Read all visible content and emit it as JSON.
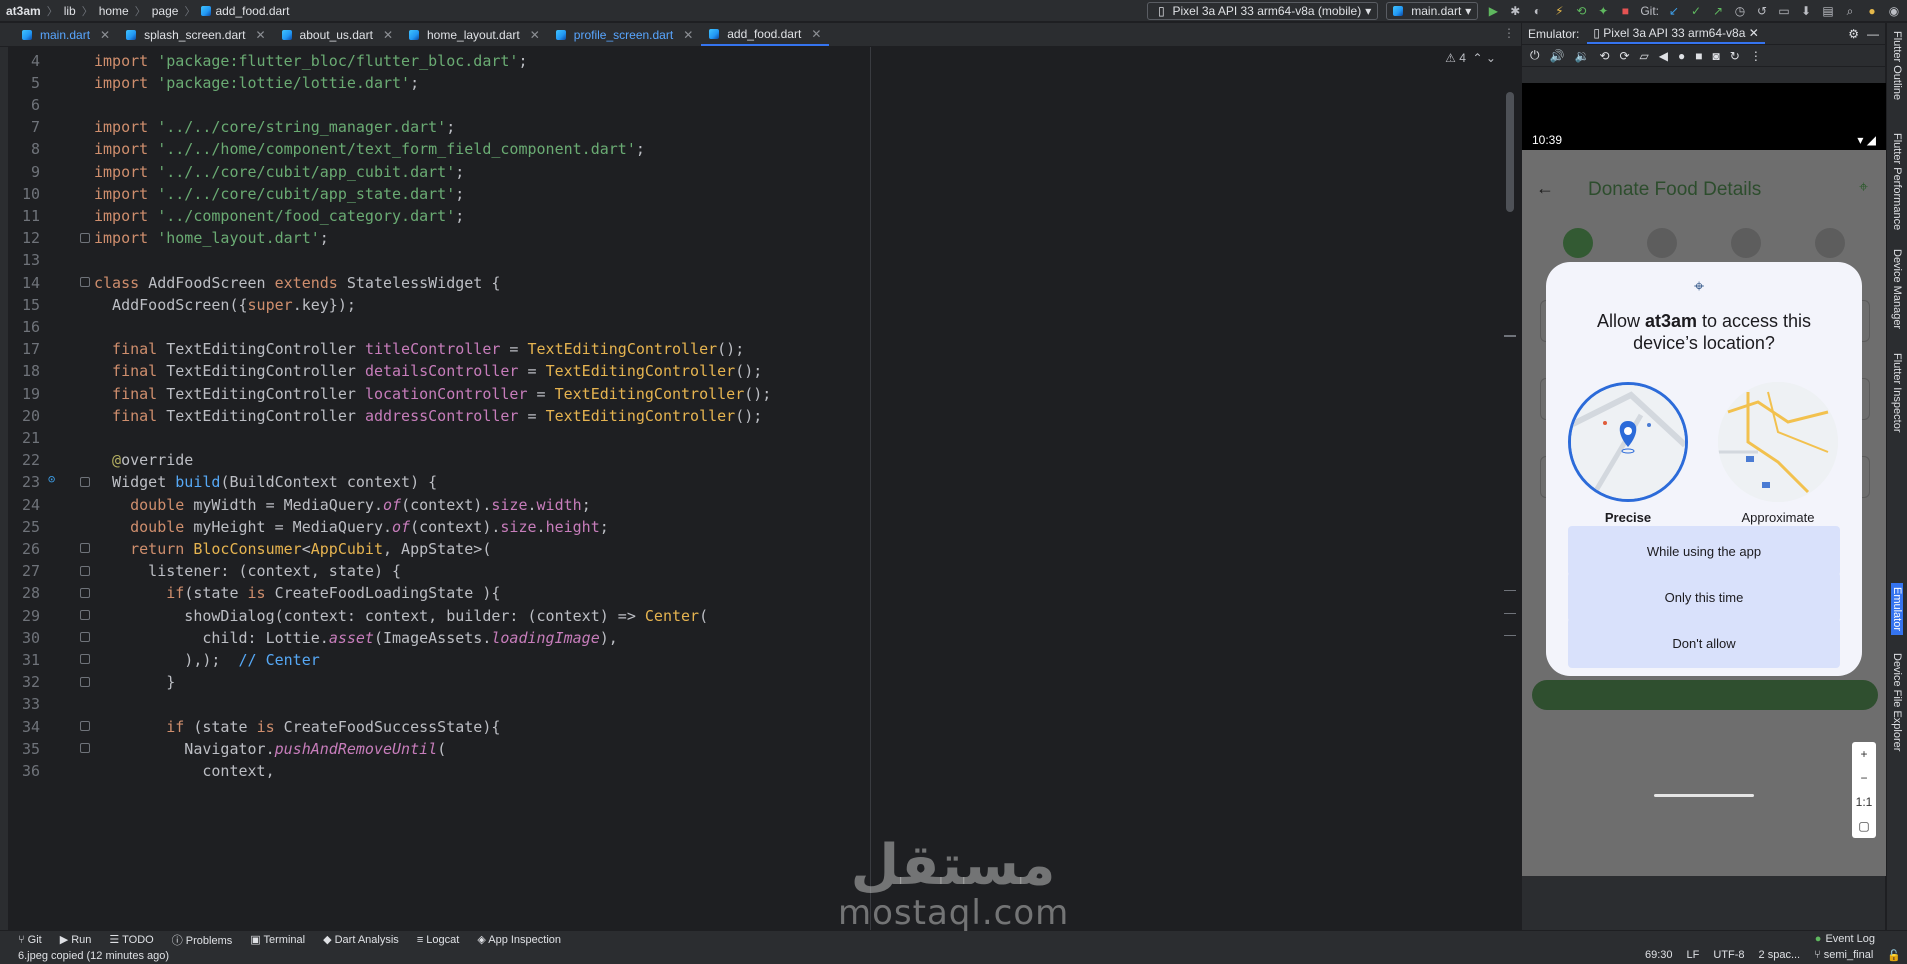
{
  "breadcrumb": {
    "project": "at3am",
    "parts": [
      "lib",
      "home",
      "page"
    ],
    "file": "add_food.dart"
  },
  "toolbar": {
    "device": "Pixel 3a API 33 arm64-v8a (mobile)",
    "config": "main.dart",
    "git_label": "Git:"
  },
  "tabs": [
    {
      "label": "main.dart",
      "modified": true
    },
    {
      "label": "splash_screen.dart",
      "modified": false
    },
    {
      "label": "about_us.dart",
      "modified": false
    },
    {
      "label": "home_layout.dart",
      "modified": false
    },
    {
      "label": "profile_screen.dart",
      "modified": true
    },
    {
      "label": "add_food.dart",
      "modified": false,
      "active": true
    }
  ],
  "editor": {
    "warning_count": "4",
    "lines": [
      {
        "n": "4",
        "tokens": [
          [
            "kw",
            "import "
          ],
          [
            "str",
            "'package:flutter_bloc/flutter_bloc.dart'"
          ],
          [
            "code",
            ";"
          ]
        ]
      },
      {
        "n": "5",
        "tokens": [
          [
            "kw",
            "import "
          ],
          [
            "str",
            "'package:lottie/lottie.dart'"
          ],
          [
            "code",
            ";"
          ]
        ]
      },
      {
        "n": "6",
        "tokens": []
      },
      {
        "n": "7",
        "tokens": [
          [
            "kw",
            "import "
          ],
          [
            "str",
            "'../../core/string_manager.dart'"
          ],
          [
            "code",
            ";"
          ]
        ]
      },
      {
        "n": "8",
        "tokens": [
          [
            "kw",
            "import "
          ],
          [
            "str",
            "'../../home/component/text_form_field_component.dart'"
          ],
          [
            "code",
            ";"
          ]
        ]
      },
      {
        "n": "9",
        "tokens": [
          [
            "kw",
            "import "
          ],
          [
            "str",
            "'../../core/cubit/app_cubit.dart'"
          ],
          [
            "code",
            ";"
          ]
        ]
      },
      {
        "n": "10",
        "tokens": [
          [
            "kw",
            "import "
          ],
          [
            "str",
            "'../../core/cubit/app_state.dart'"
          ],
          [
            "code",
            ";"
          ]
        ]
      },
      {
        "n": "11",
        "tokens": [
          [
            "kw",
            "import "
          ],
          [
            "str",
            "'../component/food_category.dart'"
          ],
          [
            "code",
            ";"
          ]
        ]
      },
      {
        "n": "12",
        "tokens": [
          [
            "kw",
            "import "
          ],
          [
            "str",
            "'home_layout.dart'"
          ],
          [
            "code",
            ";"
          ]
        ]
      },
      {
        "n": "13",
        "tokens": []
      },
      {
        "n": "14",
        "tokens": [
          [
            "kw",
            "class "
          ],
          [
            "code",
            "AddFoodScreen "
          ],
          [
            "kw",
            "extends "
          ],
          [
            "code",
            "StatelessWidget {"
          ]
        ]
      },
      {
        "n": "15",
        "tokens": [
          [
            "code",
            "  AddFoodScreen({"
          ],
          [
            "kw",
            "super"
          ],
          [
            "code",
            ".key});"
          ]
        ]
      },
      {
        "n": "16",
        "tokens": []
      },
      {
        "n": "17",
        "tokens": [
          [
            "kw",
            "  final "
          ],
          [
            "code",
            "TextEditingController "
          ],
          [
            "fld",
            "titleController"
          ],
          [
            "code",
            " = "
          ],
          [
            "ctor",
            "TextEditingController"
          ],
          [
            "code",
            "();"
          ]
        ]
      },
      {
        "n": "18",
        "tokens": [
          [
            "kw",
            "  final "
          ],
          [
            "code",
            "TextEditingController "
          ],
          [
            "fld",
            "detailsController"
          ],
          [
            "code",
            " = "
          ],
          [
            "ctor",
            "TextEditingController"
          ],
          [
            "code",
            "();"
          ]
        ]
      },
      {
        "n": "19",
        "tokens": [
          [
            "kw",
            "  final "
          ],
          [
            "code",
            "TextEditingController "
          ],
          [
            "fld",
            "locationController"
          ],
          [
            "code",
            " = "
          ],
          [
            "ctor",
            "TextEditingController"
          ],
          [
            "code",
            "();"
          ]
        ]
      },
      {
        "n": "20",
        "tokens": [
          [
            "kw",
            "  final "
          ],
          [
            "code",
            "TextEditingController "
          ],
          [
            "fld",
            "addressController"
          ],
          [
            "code",
            " = "
          ],
          [
            "ctor",
            "TextEditingController"
          ],
          [
            "code",
            "();"
          ]
        ]
      },
      {
        "n": "21",
        "tokens": []
      },
      {
        "n": "22",
        "tokens": [
          [
            "ann",
            "  @"
          ],
          [
            "code",
            "override"
          ]
        ]
      },
      {
        "n": "23",
        "tokens": [
          [
            "code",
            "  Widget "
          ],
          [
            "meth",
            "build"
          ],
          [
            "code",
            "(BuildContext context) {"
          ]
        ]
      },
      {
        "n": "24",
        "tokens": [
          [
            "kw",
            "    double "
          ],
          [
            "code",
            "myWidth = MediaQuery."
          ],
          [
            "ital",
            "of"
          ],
          [
            "code",
            "(context)."
          ],
          [
            "fld",
            "size"
          ],
          [
            "code",
            "."
          ],
          [
            "fld",
            "width"
          ],
          [
            "code",
            ";"
          ]
        ]
      },
      {
        "n": "25",
        "tokens": [
          [
            "kw",
            "    double "
          ],
          [
            "code",
            "myHeight = MediaQuery."
          ],
          [
            "ital",
            "of"
          ],
          [
            "code",
            "(context)."
          ],
          [
            "fld",
            "size"
          ],
          [
            "code",
            "."
          ],
          [
            "fld",
            "height"
          ],
          [
            "code",
            ";"
          ]
        ]
      },
      {
        "n": "26",
        "tokens": [
          [
            "kw",
            "    return "
          ],
          [
            "ctor",
            "BlocConsumer"
          ],
          [
            "code",
            "<"
          ],
          [
            "ctor",
            "AppCubit"
          ],
          [
            "code",
            ", AppState>("
          ]
        ]
      },
      {
        "n": "27",
        "tokens": [
          [
            "code",
            "      listener: (context, state) {"
          ]
        ]
      },
      {
        "n": "28",
        "tokens": [
          [
            "kw",
            "        if"
          ],
          [
            "code",
            "(state "
          ],
          [
            "kw",
            "is "
          ],
          [
            "code",
            "CreateFoodLoadingState ){"
          ]
        ]
      },
      {
        "n": "29",
        "tokens": [
          [
            "code",
            "          showDialog(context: context, builder: (context) => "
          ],
          [
            "ctor",
            "Center"
          ],
          [
            "code",
            "("
          ]
        ]
      },
      {
        "n": "30",
        "tokens": [
          [
            "code",
            "            child: Lottie."
          ],
          [
            "ital",
            "asset"
          ],
          [
            "code",
            "(ImageAssets."
          ],
          [
            "ital",
            "loadingImage"
          ],
          [
            "code",
            "),"
          ]
        ]
      },
      {
        "n": "31",
        "tokens": [
          [
            "code",
            "          ),);  "
          ],
          [
            "cm",
            "// Center"
          ]
        ]
      },
      {
        "n": "32",
        "tokens": [
          [
            "code",
            "        }"
          ]
        ]
      },
      {
        "n": "33",
        "tokens": []
      },
      {
        "n": "34",
        "tokens": [
          [
            "kw",
            "        if "
          ],
          [
            "code",
            "(state "
          ],
          [
            "kw",
            "is "
          ],
          [
            "code",
            "CreateFoodSuccessState){"
          ]
        ]
      },
      {
        "n": "35",
        "tokens": [
          [
            "code",
            "          Navigator."
          ],
          [
            "ital",
            "pushAndRemoveUntil"
          ],
          [
            "code",
            "("
          ]
        ]
      },
      {
        "n": "36",
        "tokens": [
          [
            "code",
            "            context,"
          ]
        ]
      }
    ]
  },
  "emulator": {
    "panel_label": "Emulator:",
    "tab_label": "Pixel 3a API 33 arm64-v8a",
    "time": "10:39",
    "app_title": "Donate Food Details",
    "dialog": {
      "question_prefix": "Allow ",
      "app_name": "at3am",
      "question_suffix": " to access this device’s location?",
      "precise_label": "Precise",
      "approximate_label": "Approximate",
      "btn_while_using": "While using the app",
      "btn_only_this_time": "Only this time",
      "btn_dont_allow": "Don't allow"
    },
    "zoom": {
      "plus": "+",
      "minus": "−",
      "ratio": "1:1"
    }
  },
  "right_tools": [
    "Flutter Outline",
    "Flutter Performance",
    "Device Manager",
    "Flutter Inspector",
    "Emulator",
    "Device File Explorer"
  ],
  "bottom_tools": [
    "Git",
    "Run",
    "TODO",
    "Problems",
    "Terminal",
    "Dart Analysis",
    "Logcat",
    "App Inspection"
  ],
  "event_log": "Event Log",
  "status": {
    "message": "6.jpeg copied (12 minutes ago)",
    "position": "69:30",
    "line_sep": "LF",
    "encoding": "UTF-8",
    "indent": "2 spac...",
    "branch": "semi_final"
  },
  "watermark": {
    "arabic": "مستقل",
    "latin": "mostaql.com"
  }
}
